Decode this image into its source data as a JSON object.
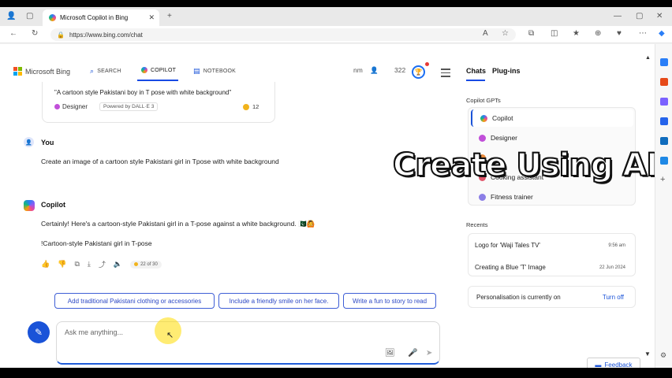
{
  "browser": {
    "tab_title": "Microsoft Copilot in Bing",
    "tab_close": "✕",
    "new_tab": "+",
    "url": "https://www.bing.com/chat",
    "window_controls": [
      "—",
      "▢",
      "✕"
    ]
  },
  "header": {
    "logo_text": "Microsoft Bing",
    "nav": [
      {
        "label": "SEARCH",
        "icon": "search-icon"
      },
      {
        "label": "COPILOT",
        "icon": "copilot-icon"
      },
      {
        "label": "NOTEBOOK",
        "icon": "notebook-icon"
      }
    ],
    "user_initials": "nm",
    "points": "322"
  },
  "chat": {
    "previous_card": {
      "prompt": "\"A cartoon style Pakistani boy in T pose with white background\"",
      "designer": "Designer",
      "powered_by": "Powered by DALL·E 3",
      "boosts": "12"
    },
    "user_name": "You",
    "user_message": "Create an image of a cartoon style Pakistani girl in Tpose with white background",
    "bot_name": "Copilot",
    "bot_message": "Certainly! Here's a cartoon-style Pakistani girl in a T-pose against a white background. 🇵🇰🙆",
    "image_alt": "!Cartoon-style Pakistani girl in T-pose",
    "turn_counter": "22 of 30"
  },
  "suggestions": [
    "Add traditional Pakistani clothing or accessories",
    "Include a friendly smile on her face.",
    "Write a fun to story to read"
  ],
  "composer": {
    "placeholder": "Ask me anything..."
  },
  "right_panel": {
    "tabs": [
      "Chats",
      "Plug-ins"
    ],
    "gpts_label": "Copilot GPTs",
    "gpts": [
      {
        "label": "Copilot",
        "color": "#2a7ef7"
      },
      {
        "label": "Designer",
        "color": "#c14fd9"
      },
      {
        "label": "",
        "color": "#e98a3a"
      },
      {
        "label": "Cooking assistant",
        "color": "#e0556a"
      },
      {
        "label": "Fitness trainer",
        "color": "#8b7ee6"
      }
    ],
    "recents_label": "Recents",
    "recents": [
      {
        "title": "Logo for 'Waji Tales TV'",
        "time": "9:56 am"
      },
      {
        "title": "Creating a Blue 'T' Image",
        "time": "22 Jun 2024"
      }
    ],
    "personalisation": "Personalisation is currently on",
    "turn_off": "Turn off"
  },
  "overlay_text": "Create Using AI",
  "feedback": "Feedback",
  "colors": {
    "accent": "#1a53d8",
    "suggestion_border": "#3e5ed6",
    "overlay_fill": "#ffffff"
  }
}
